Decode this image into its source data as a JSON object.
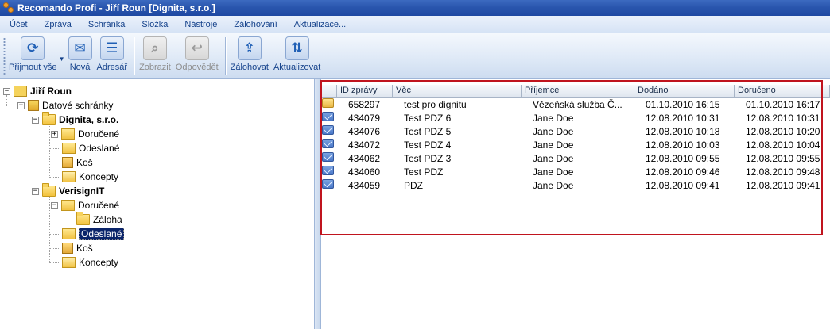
{
  "window": {
    "title": "Recomando Profi - Jiří Roun [Dignita, s.r.o.]"
  },
  "menu": [
    "Účet",
    "Zpráva",
    "Schránka",
    "Složka",
    "Nástroje",
    "Zálohování",
    "Aktualizace..."
  ],
  "toolbar": {
    "receive_all": "Přijmout vše",
    "new": "Nová",
    "address_book": "Adresář",
    "show": "Zobrazit",
    "reply": "Odpovědět",
    "backup": "Zálohovat",
    "update": "Aktualizovat"
  },
  "tree": {
    "root": "Jiří Roun",
    "datove_schranky": "Datové schránky",
    "box1": {
      "name": "Dignita, s.r.o.",
      "inbox": "Doručené",
      "sent": "Odeslané",
      "trash": "Koš",
      "drafts": "Koncepty"
    },
    "box2": {
      "name": "VerisignIT",
      "inbox": "Doručené",
      "backup": "Záloha",
      "sent": "Odeslané",
      "trash": "Koš",
      "drafts": "Koncepty"
    }
  },
  "grid": {
    "columns": [
      "ID zprávy",
      "Věc",
      "Příjemce",
      "Dodáno",
      "Doručeno"
    ],
    "rows": [
      {
        "icon": "inbox-message-icon",
        "id": "658297",
        "subject": "test pro dignitu",
        "recipient": "Vězeňská služba Č...",
        "delivered": "01.10.2010 16:15",
        "received": "01.10.2010 16:17"
      },
      {
        "icon": "envelope-icon",
        "id": "434079",
        "subject": "Test PDZ 6",
        "recipient": "Jane Doe",
        "delivered": "12.08.2010 10:31",
        "received": "12.08.2010 10:31"
      },
      {
        "icon": "envelope-icon",
        "id": "434076",
        "subject": "Test PDZ 5",
        "recipient": "Jane Doe",
        "delivered": "12.08.2010 10:18",
        "received": "12.08.2010 10:20"
      },
      {
        "icon": "envelope-icon",
        "id": "434072",
        "subject": "Test PDZ 4",
        "recipient": "Jane Doe",
        "delivered": "12.08.2010 10:03",
        "received": "12.08.2010 10:04"
      },
      {
        "icon": "envelope-icon",
        "id": "434062",
        "subject": "Test PDZ 3",
        "recipient": "Jane Doe",
        "delivered": "12.08.2010 09:55",
        "received": "12.08.2010 09:55"
      },
      {
        "icon": "envelope-icon",
        "id": "434060",
        "subject": "Test PDZ",
        "recipient": "Jane Doe",
        "delivered": "12.08.2010 09:46",
        "received": "12.08.2010 09:48"
      },
      {
        "icon": "envelope-icon",
        "id": "434059",
        "subject": "PDZ",
        "recipient": "Jane Doe",
        "delivered": "12.08.2010 09:41",
        "received": "12.08.2010 09:41"
      }
    ]
  },
  "colors": {
    "title_bar": "#2a56ae",
    "menu_text": "#15428b",
    "selection": "#0a246a",
    "highlight_rect": "#c0141e"
  }
}
